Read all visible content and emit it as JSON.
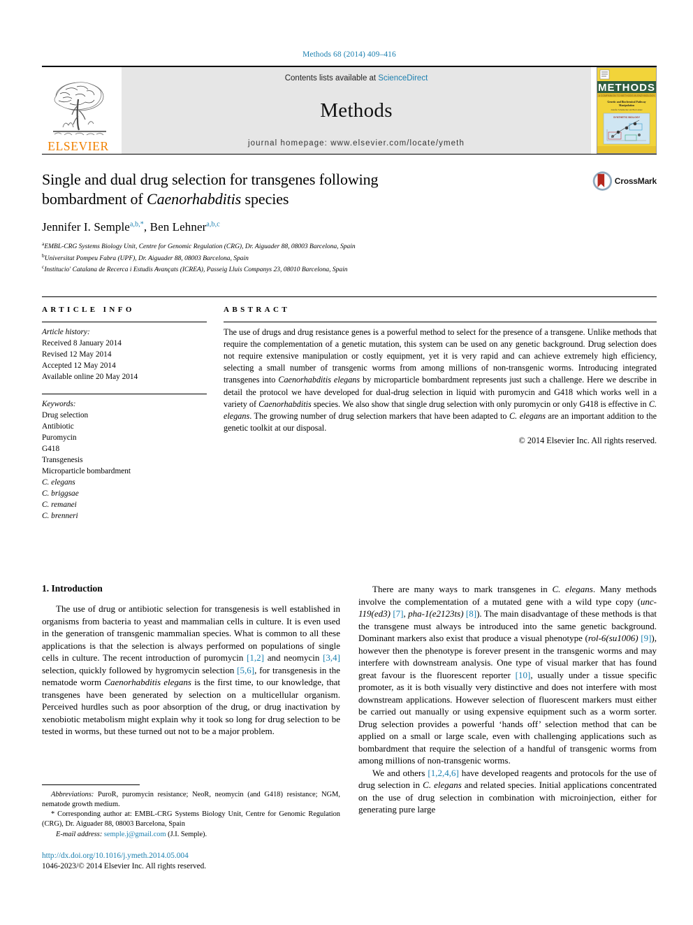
{
  "running_head": "Methods 68 (2014) 409–416",
  "masthead": {
    "publisher_logo_name": "ELSEVIER",
    "contents_prefix": "Contents lists available at ",
    "contents_link": "ScienceDirect",
    "journal_name": "Methods",
    "homepage_line": "journal homepage: www.elsevier.com/locate/ymeth",
    "cover_title": "METHODS",
    "cover_subtitle": "A COMPANION TO METHODS IN ENZYMOLOGY",
    "cover_issue": "Genetic and Biochemical Pathway Manipulation",
    "cover_editors": "Jennifer Schumacher and Ben Lehner",
    "cover_topic": "SYNTHETIC BIOLOGY"
  },
  "article": {
    "title_line1": "Single and dual drug selection for transgenes following",
    "title_line2_pre": "bombardment of ",
    "title_line2_italic": "Caenorhabditis",
    "title_line2_post": " species",
    "authors": [
      {
        "name": "Jennifer I. Semple",
        "sup": "a,b,*"
      },
      {
        "name": "Ben Lehner",
        "sup": "a,b,c"
      }
    ],
    "author_separator": ", ",
    "affiliations": [
      {
        "sup": "a",
        "text": "EMBL-CRG Systems Biology Unit, Centre for Genomic Regulation (CRG), Dr. Aiguader 88, 08003 Barcelona, Spain"
      },
      {
        "sup": "b",
        "text": "Universitat Pompeu Fabra (UPF), Dr. Aiguader 88, 08003 Barcelona, Spain"
      },
      {
        "sup": "c",
        "text": "Institucio' Catalana de Recerca i Estudis Avançats (ICREA), Passeig Lluis Companys 23, 08010 Barcelona, Spain"
      }
    ],
    "crossmark_label": "CrossMark"
  },
  "article_info": {
    "heading": "ARTICLE INFO",
    "history_label": "Article history:",
    "history": [
      "Received 8 January 2014",
      "Revised 12 May 2014",
      "Accepted 12 May 2014",
      "Available online 20 May 2014"
    ],
    "keywords_label": "Keywords:",
    "keywords": [
      "Drug selection",
      "Antibiotic",
      "Puromycin",
      "G418",
      "Transgenesis",
      "Microparticle bombardment",
      "C. elegans",
      "C. briggsae",
      "C. remanei",
      "C. brenneri"
    ]
  },
  "abstract": {
    "heading": "ABSTRACT",
    "paragraph_parts": [
      {
        "t": "The use of drugs and drug resistance genes is a powerful method to select for the presence of a transgene. Unlike methods that require the complementation of a genetic mutation, this system can be used on any genetic background. Drug selection does not require extensive manipulation or costly equipment, yet it is very rapid and can achieve extremely high efficiency, selecting a small number of transgenic worms from among millions of non-transgenic worms. Introducing integrated transgenes into "
      },
      {
        "t": "Caenorhabditis elegans",
        "i": true
      },
      {
        "t": " by microparticle bombardment represents just such a challenge. Here we describe in detail the protocol we have developed for dual-drug selection in liquid with puromycin and G418 which works well in a variety of "
      },
      {
        "t": "Caenorhabditis",
        "i": true
      },
      {
        "t": " species. We also show that single drug selection with only puromycin or only G418 is effective in "
      },
      {
        "t": "C. elegans",
        "i": true
      },
      {
        "t": ". The growing number of drug selection markers that have been adapted to "
      },
      {
        "t": "C. elegans",
        "i": true
      },
      {
        "t": " are an important addition to the genetic toolkit at our disposal."
      }
    ],
    "copyright": "© 2014 Elsevier Inc. All rights reserved."
  },
  "introduction": {
    "heading": "1. Introduction",
    "left_paragraphs": [
      [
        {
          "t": "The use of drug or antibiotic selection for transgenesis is well established in organisms from bacteria to yeast and mammalian cells in culture. It is even used in the generation of transgenic mammalian species. What is common to all these applications is that the selection is always performed on populations of single cells in culture. The recent introduction of puromycin "
        },
        {
          "t": "[1,2]",
          "r": true
        },
        {
          "t": " and neomycin "
        },
        {
          "t": "[3,4]",
          "r": true
        },
        {
          "t": " selection, quickly followed by hygromycin selection "
        },
        {
          "t": "[5,6]",
          "r": true
        },
        {
          "t": ", for transgenesis in the nematode worm "
        },
        {
          "t": "Caenorhabditis elegans",
          "i": true
        },
        {
          "t": " is the first time, to our knowledge, that transgenes have been generated by selection on a multicellular organism. Perceived hurdles such as poor absorption of the drug, or drug inactivation by xenobiotic metabolism might explain why it took so long for drug selection to be tested in worms, but these turned out not to be a major problem."
        }
      ]
    ],
    "right_paragraphs": [
      [
        {
          "t": "There are many ways to mark transgenes in "
        },
        {
          "t": "C. elegans",
          "i": true
        },
        {
          "t": ". Many methods involve the complementation of a mutated gene with a wild type copy ("
        },
        {
          "t": "unc-119(ed3)",
          "i": true
        },
        {
          "t": " "
        },
        {
          "t": "[7]",
          "r": true
        },
        {
          "t": ", "
        },
        {
          "t": "pha-1(e2123ts)",
          "i": true
        },
        {
          "t": " "
        },
        {
          "t": "[8]",
          "r": true
        },
        {
          "t": "). The main disadvantage of these methods is that the transgene must always be introduced into the same genetic background. Dominant markers also exist that produce a visual phenotype ("
        },
        {
          "t": "rol-6(su1006)",
          "i": true
        },
        {
          "t": " "
        },
        {
          "t": "[9]",
          "r": true
        },
        {
          "t": "), however then the phenotype is forever present in the transgenic worms and may interfere with downstream analysis. One type of visual marker that has found great favour is the fluorescent reporter "
        },
        {
          "t": "[10]",
          "r": true
        },
        {
          "t": ", usually under a tissue specific promoter, as it is both visually very distinctive and does not interfere with most downstream applications. However selection of fluorescent markers must either be carried out manually or using expensive equipment such as a worm sorter. Drug selection provides a powerful ‘hands off’ selection method that can be applied on a small or large scale, even with challenging applications such as bombardment that require the selection of a handful of transgenic worms from among millions of non-transgenic worms."
        }
      ],
      [
        {
          "t": "We and others "
        },
        {
          "t": "[1,2,4,6]",
          "r": true
        },
        {
          "t": " have developed reagents and protocols for the use of drug selection in "
        },
        {
          "t": "C. elegans",
          "i": true
        },
        {
          "t": " and related species. Initial applications concentrated on the use of drug selection in combination with microinjection, either for generating pure large"
        }
      ]
    ]
  },
  "footnotes": {
    "abbreviations_label": "Abbreviations:",
    "abbreviations_text": " PuroR, puromycin resistance; NeoR, neomycin (and G418) resistance; NGM, nematode growth medium.",
    "corresponding_marker": "*",
    "corresponding_text": " Corresponding author at: EMBL-CRG Systems Biology Unit, Centre for Genomic Regulation (CRG), Dr. Aiguader 88, 08003 Barcelona, Spain",
    "email_label": "E-mail address:",
    "email_value": "semple.j@gmail.com",
    "email_owner": " (J.I. Semple).",
    "doi": "http://dx.doi.org/10.1016/j.ymeth.2014.05.004",
    "issn_line": "1046-2023/© 2014 Elsevier Inc. All rights reserved."
  },
  "colors": {
    "link_blue": "#1b7faf",
    "elsevier_orange": "#f08000",
    "band_gray": "#e6e6e6",
    "cover_yellow": "#f2d43a",
    "crossmark_red": "#b5281e"
  }
}
